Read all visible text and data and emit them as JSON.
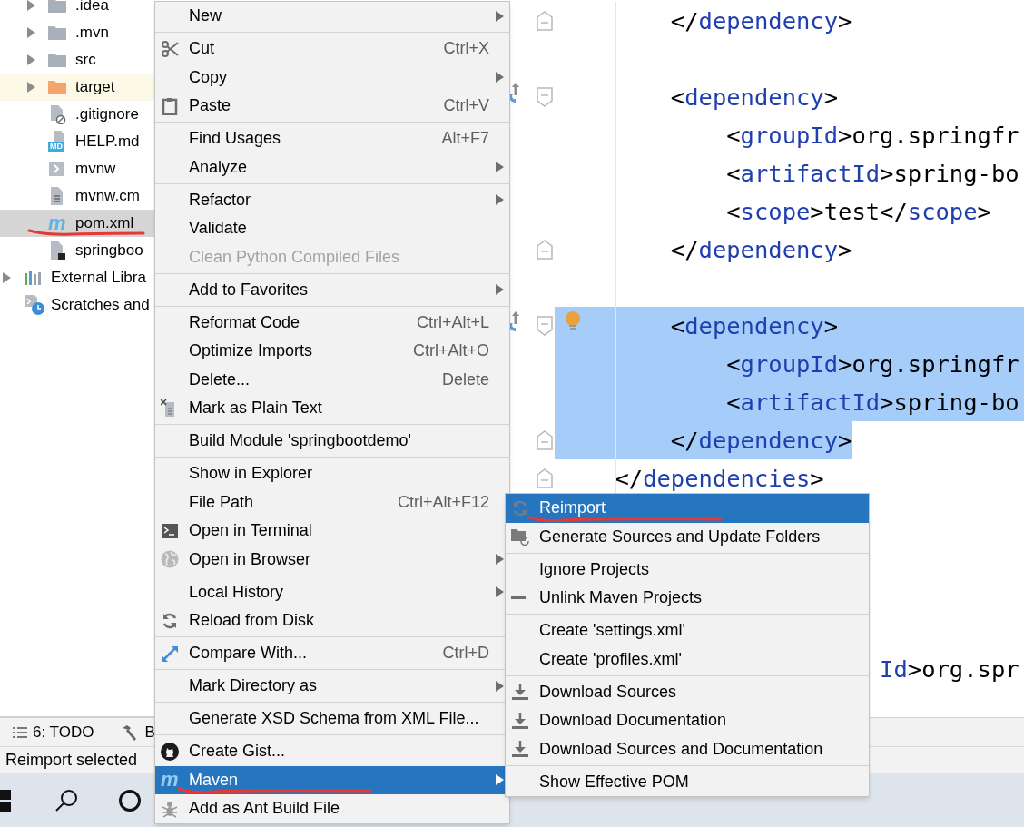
{
  "project_tree": {
    "files": [
      {
        "label": ".idea",
        "kind": "folder",
        "expanded": false,
        "selected": false,
        "annotated": false
      },
      {
        "label": ".mvn",
        "kind": "folder",
        "expanded": false,
        "selected": false,
        "annotated": false
      },
      {
        "label": "src",
        "kind": "folder",
        "expanded": false,
        "selected": false,
        "annotated": false
      },
      {
        "label": "target",
        "kind": "excluded-folder",
        "expanded": false,
        "selected": false,
        "annotated": false
      },
      {
        "label": ".gitignore",
        "kind": "ignore-file",
        "selected": false,
        "annotated": false
      },
      {
        "label": "HELP.md",
        "kind": "markdown",
        "badge": "MD",
        "selected": false,
        "annotated": false
      },
      {
        "label": "mvnw",
        "kind": "script",
        "selected": false,
        "annotated": false
      },
      {
        "label": "mvnw.cm",
        "kind": "text",
        "selected": false,
        "annotated": false
      },
      {
        "label": "pom.xml",
        "kind": "maven",
        "glyph": "m",
        "selected": true,
        "annotated": true
      },
      {
        "label": "springboo",
        "kind": "module",
        "selected": false,
        "annotated": false
      }
    ],
    "roots": [
      {
        "label": "External Libra",
        "kind": "libraries",
        "expanded": false,
        "selected": false,
        "annotated": false
      },
      {
        "label": "Scratches and",
        "kind": "scratches",
        "selected": false,
        "annotated": false
      }
    ]
  },
  "editor": {
    "lines": [
      {
        "text": "        </dependency>",
        "kind": "fold-end",
        "selected": false,
        "marker": false,
        "bulb": false
      },
      {
        "kind": "blank"
      },
      {
        "text": "        <dependency>",
        "kind": "fold-start",
        "selected": false,
        "marker": true,
        "bulb": false
      },
      {
        "text": "            <groupId>org.springfr",
        "kind": "plain",
        "selected": false,
        "marker": false,
        "bulb": false
      },
      {
        "text": "            <artifactId>spring-bo",
        "kind": "plain",
        "selected": false,
        "marker": false,
        "bulb": false
      },
      {
        "text": "            <scope>test</scope>",
        "kind": "plain",
        "selected": false,
        "marker": false,
        "bulb": false
      },
      {
        "text": "        </dependency>",
        "kind": "fold-end",
        "selected": false,
        "marker": false,
        "bulb": false
      },
      {
        "kind": "blank"
      },
      {
        "text": "        <dependency>",
        "kind": "fold-start",
        "selected": true,
        "marker": true,
        "bulb": true
      },
      {
        "text": "            <groupId>org.springfr",
        "kind": "plain",
        "selected": true,
        "marker": false,
        "bulb": false
      },
      {
        "text": "            <artifactId>spring-bo",
        "kind": "plain",
        "selected": true,
        "marker": false,
        "bulb": false
      },
      {
        "text": "        </dependency>",
        "kind": "fold-end",
        "selected": true,
        "marker": false,
        "bulb": false
      },
      {
        "text": "    </dependencies>",
        "kind": "fold-end",
        "selected": false,
        "marker": false,
        "bulb": false
      },
      {
        "kind": "blank"
      },
      {
        "kind": "blank"
      },
      {
        "kind": "blank"
      },
      {
        "kind": "blank"
      },
      {
        "text": "                       Id>org.spr",
        "kind": "plain",
        "selected": false,
        "marker": false,
        "bulb": false
      }
    ]
  },
  "tool_window_bar": {
    "todo": "6: TODO",
    "build": "B"
  },
  "status_bar": {
    "message": "Reimport selected"
  },
  "context_menu": {
    "sections": [
      {
        "items": [
          {
            "label": "New",
            "kind": "submenu",
            "disabled": false,
            "selected": false,
            "annotated": false
          }
        ]
      },
      {
        "items": [
          {
            "label": "Cut",
            "shortcut": "Ctrl+X",
            "kind": "command",
            "disabled": false,
            "selected": false,
            "annotated": false
          },
          {
            "label": "Copy",
            "kind": "submenu",
            "disabled": false,
            "selected": false,
            "annotated": false
          },
          {
            "label": "Paste",
            "shortcut": "Ctrl+V",
            "kind": "command",
            "disabled": false,
            "selected": false,
            "annotated": false
          }
        ]
      },
      {
        "items": [
          {
            "label": "Find Usages",
            "shortcut": "Alt+F7",
            "kind": "command",
            "disabled": false,
            "selected": false,
            "annotated": false
          },
          {
            "label": "Analyze",
            "kind": "submenu",
            "disabled": false,
            "selected": false,
            "annotated": false
          }
        ]
      },
      {
        "items": [
          {
            "label": "Refactor",
            "kind": "submenu",
            "disabled": false,
            "selected": false,
            "annotated": false
          },
          {
            "label": "Validate",
            "kind": "command",
            "disabled": false,
            "selected": false,
            "annotated": false
          },
          {
            "label": "Clean Python Compiled Files",
            "kind": "command",
            "disabled": true,
            "selected": false,
            "annotated": false
          }
        ]
      },
      {
        "items": [
          {
            "label": "Add to Favorites",
            "kind": "submenu",
            "disabled": false,
            "selected": false,
            "annotated": false
          }
        ]
      },
      {
        "items": [
          {
            "label": "Reformat Code",
            "shortcut": "Ctrl+Alt+L",
            "kind": "command",
            "disabled": false,
            "selected": false,
            "annotated": false
          },
          {
            "label": "Optimize Imports",
            "shortcut": "Ctrl+Alt+O",
            "kind": "command",
            "disabled": false,
            "selected": false,
            "annotated": false
          },
          {
            "label": "Delete...",
            "shortcut": "Delete",
            "kind": "command",
            "disabled": false,
            "selected": false,
            "annotated": false
          },
          {
            "label": "Mark as Plain Text",
            "kind": "command",
            "disabled": false,
            "selected": false,
            "annotated": false
          }
        ]
      },
      {
        "items": [
          {
            "label": "Build Module 'springbootdemo'",
            "kind": "command",
            "disabled": false,
            "selected": false,
            "annotated": false
          }
        ]
      },
      {
        "items": [
          {
            "label": "Show in Explorer",
            "kind": "command",
            "disabled": false,
            "selected": false,
            "annotated": false
          },
          {
            "label": "File Path",
            "shortcut": "Ctrl+Alt+F12",
            "kind": "command",
            "disabled": false,
            "selected": false,
            "annotated": false
          },
          {
            "label": "Open in Terminal",
            "kind": "command",
            "disabled": false,
            "selected": false,
            "annotated": false
          },
          {
            "label": "Open in Browser",
            "kind": "submenu",
            "disabled": false,
            "selected": false,
            "annotated": false
          }
        ]
      },
      {
        "items": [
          {
            "label": "Local History",
            "kind": "submenu",
            "disabled": false,
            "selected": false,
            "annotated": false
          },
          {
            "label": "Reload from Disk",
            "kind": "command",
            "disabled": false,
            "selected": false,
            "annotated": false
          }
        ]
      },
      {
        "items": [
          {
            "label": "Compare With...",
            "shortcut": "Ctrl+D",
            "kind": "command",
            "disabled": false,
            "selected": false,
            "annotated": false
          }
        ]
      },
      {
        "items": [
          {
            "label": "Mark Directory as",
            "kind": "submenu",
            "disabled": false,
            "selected": false,
            "annotated": false
          }
        ]
      },
      {
        "items": [
          {
            "label": "Generate XSD Schema from XML File...",
            "kind": "command",
            "disabled": false,
            "selected": false,
            "annotated": false
          }
        ]
      },
      {
        "items": [
          {
            "label": "Create Gist...",
            "kind": "command",
            "disabled": false,
            "selected": false,
            "annotated": false
          },
          {
            "label": "Maven",
            "glyph": "m",
            "kind": "submenu",
            "disabled": false,
            "selected": true,
            "annotated": true
          },
          {
            "label": "Add as Ant Build File",
            "kind": "command",
            "disabled": false,
            "selected": false,
            "annotated": false
          }
        ]
      }
    ]
  },
  "maven_submenu": {
    "sections": [
      {
        "items": [
          {
            "label": "Reimport",
            "disabled": false,
            "selected": true,
            "annotated": true
          },
          {
            "label": "Generate Sources and Update Folders",
            "disabled": false,
            "selected": false,
            "annotated": false
          }
        ]
      },
      {
        "items": [
          {
            "label": "Ignore Projects",
            "disabled": false,
            "selected": false,
            "annotated": false
          },
          {
            "label": "Unlink Maven Projects",
            "disabled": false,
            "selected": false,
            "annotated": false
          }
        ]
      },
      {
        "items": [
          {
            "label": "Create 'settings.xml'",
            "disabled": false,
            "selected": false,
            "annotated": false
          },
          {
            "label": "Create 'profiles.xml'",
            "disabled": false,
            "selected": false,
            "annotated": false
          }
        ]
      },
      {
        "items": [
          {
            "label": "Download Sources",
            "disabled": false,
            "selected": false,
            "annotated": false
          },
          {
            "label": "Download Documentation",
            "disabled": false,
            "selected": false,
            "annotated": false
          },
          {
            "label": "Download Sources and Documentation",
            "disabled": false,
            "selected": false,
            "annotated": false
          }
        ]
      },
      {
        "items": [
          {
            "label": "Show Effective POM",
            "disabled": false,
            "selected": false,
            "annotated": false
          }
        ]
      }
    ]
  }
}
